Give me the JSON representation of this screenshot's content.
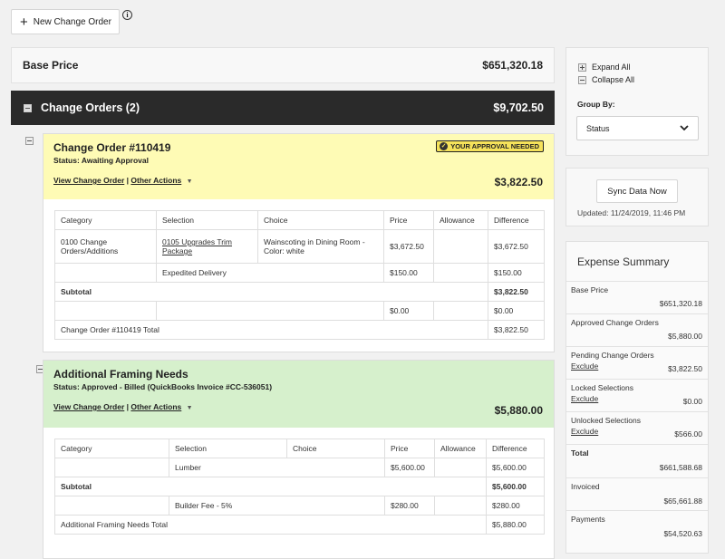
{
  "toolbar": {
    "new_change_order": "New Change Order"
  },
  "base_price": {
    "label": "Base Price",
    "value": "$651,320.18"
  },
  "change_orders": {
    "label": "Change Orders (2)",
    "value": "$9,702.50"
  },
  "orders": [
    {
      "title": "Change Order #110419",
      "status": "Status: Awaiting Approval",
      "badge": "YOUR APPROVAL NEEDED",
      "view_link": "View Change Order",
      "other_actions": "Other Actions",
      "amount": "$3,822.50",
      "table": {
        "headers": [
          "Category",
          "Selection",
          "Choice",
          "Price",
          "Allowance",
          "Difference"
        ],
        "row1": {
          "category": "0100 Change Orders/Additions",
          "selection": "0105 Upgrades Trim Package",
          "choice": "Wainscoting in Dining Room - Color: white",
          "price": "$3,672.50",
          "allowance": "",
          "difference": "$3,672.50"
        },
        "row2": {
          "selection": "Expedited Delivery",
          "price": "$150.00",
          "difference": "$150.00"
        },
        "subtotal_label": "Subtotal",
        "subtotal_value": "$3,822.50",
        "row4": {
          "price": "$0.00",
          "difference": "$0.00"
        },
        "total_label": "Change Order #110419 Total",
        "total_value": "$3,822.50"
      }
    },
    {
      "title": "Additional Framing Needs",
      "status": "Status: Approved - Billed (QuickBooks Invoice #CC-536051)",
      "view_link": "View Change Order",
      "other_actions": "Other Actions",
      "amount": "$5,880.00",
      "table": {
        "headers": [
          "Category",
          "Selection",
          "Choice",
          "Price",
          "Allowance",
          "Difference"
        ],
        "row1": {
          "selection": "Lumber",
          "price": "$5,600.00",
          "difference": "$5,600.00"
        },
        "subtotal_label": "Subtotal",
        "subtotal_value": "$5,600.00",
        "row3": {
          "selection": "Builder Fee - 5%",
          "price": "$280.00",
          "difference": "$280.00"
        },
        "total_label": "Additional Framing Needs Total",
        "total_value": "$5,880.00"
      }
    }
  ],
  "sidebar": {
    "expand_all": "Expand All",
    "collapse_all": "Collapse All",
    "group_by_label": "Group By:",
    "group_by_value": "Status",
    "sync_button": "Sync Data Now",
    "updated": "Updated: 11/24/2019, 11:46 PM",
    "expense_title": "Expense Summary",
    "exclude_label": "Exclude",
    "expenses": [
      {
        "label": "Base Price",
        "value": "$651,320.18"
      },
      {
        "label": "Approved Change Orders",
        "value": "$5,880.00"
      },
      {
        "label": "Pending Change Orders",
        "value": "$3,822.50"
      },
      {
        "label": "Locked Selections",
        "value": "$0.00"
      },
      {
        "label": "Unlocked Selections",
        "value": "$566.00"
      },
      {
        "label": "Total",
        "value": "$661,588.68"
      },
      {
        "label": "Invoiced",
        "value": "$65,661.88"
      },
      {
        "label": "Payments",
        "value": "$54,520.63"
      }
    ]
  }
}
